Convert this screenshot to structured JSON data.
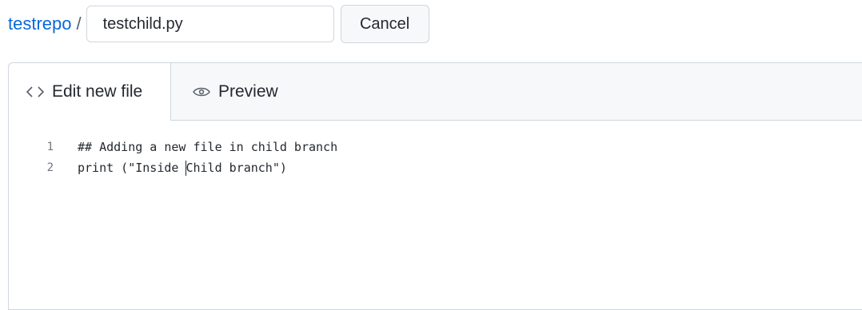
{
  "breadcrumb": {
    "repo": "testrepo",
    "separator": "/"
  },
  "filename_input": {
    "value": "testchild.py"
  },
  "cancel_button": {
    "label": "Cancel"
  },
  "tabs": [
    {
      "label": "Edit new file",
      "icon": "code-icon",
      "active": true
    },
    {
      "label": "Preview",
      "icon": "eye-icon",
      "active": false
    }
  ],
  "editor": {
    "lines": [
      {
        "number": "1",
        "text": "## Adding a new file in child branch"
      },
      {
        "number": "2",
        "text_before_caret": "print (\"Inside ",
        "text_after_caret": "Child branch\")"
      }
    ]
  },
  "colors": {
    "link": "#0969da",
    "border": "#d0d7de",
    "tabbar_bg": "#f6f8fa"
  }
}
